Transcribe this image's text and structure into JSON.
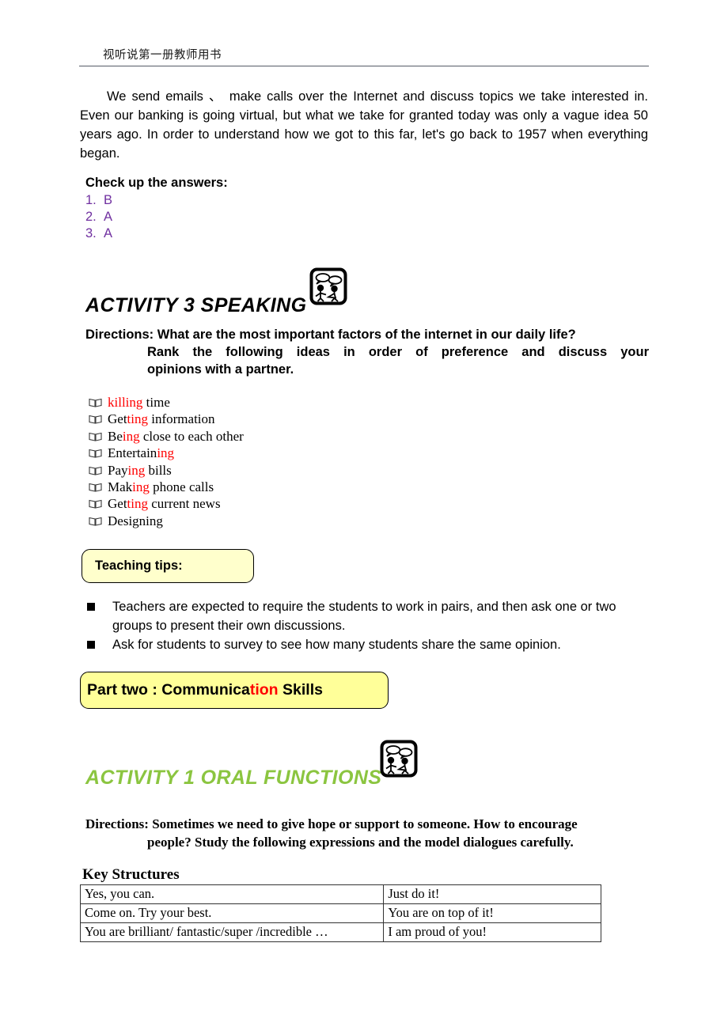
{
  "header": {
    "running_head": "视听说第一册教师用书"
  },
  "intro": {
    "paragraph": "We send emails 、 make calls over the Internet and discuss topics we take interested in. Even our banking is going virtual, but what we take for granted today was only a vague idea 50 years ago. In order to understand how we got to this far, let's go back to 1957 when everything began."
  },
  "answers": {
    "title": "Check up the answers:",
    "color": "#7030A0",
    "items": [
      {
        "number": "1.",
        "value": "B"
      },
      {
        "number": "2.",
        "value": "A"
      },
      {
        "number": "3.",
        "value": "A"
      }
    ]
  },
  "activity3": {
    "heading": "ACTIVITY 3 SPEAKING",
    "icon": "speaking-icon",
    "directions": {
      "line1": "Directions: What are the most important factors of the internet in our daily life?",
      "line2": "Rank the following ideas in order of preference and discuss your",
      "line3": "opinions with a partner."
    },
    "ideas": [
      {
        "plain_before": "",
        "highlight": "killing",
        "plain_after": " time"
      },
      {
        "plain_before": "Get",
        "highlight": "ting",
        "plain_after": " information"
      },
      {
        "plain_before": "Be",
        "highlight": "ing",
        "plain_after": " close to each other"
      },
      {
        "plain_before": "Entertain",
        "highlight": "ing",
        "plain_after": ""
      },
      {
        "plain_before": "Pay",
        "highlight": "ing",
        "plain_after": " bills"
      },
      {
        "plain_before": "Mak",
        "highlight": "ing",
        "plain_after": " phone calls"
      },
      {
        "plain_before": "Get",
        "highlight": "ting",
        "plain_after": " current news"
      },
      {
        "plain_before": "Designing",
        "highlight": "",
        "plain_after": ""
      }
    ],
    "highlight_color": "#FF0000"
  },
  "teaching_tips": {
    "box_label": "Teaching tips:",
    "box_fill": "#FFFFCC",
    "items": [
      "Teachers are expected to require the students to work in pairs, and then ask one or two groups to present their own discussions.",
      "Ask for students to survey to see how many students share the same opinion."
    ]
  },
  "part_banner": {
    "text_before": "Part two : Communica",
    "text_highlight": "tion",
    "text_after": " Skills",
    "fill": "#FFFF99",
    "highlight_color": "#FF0000"
  },
  "activity1": {
    "heading": "ACTIVITY 1 ORAL FUNCTIONS",
    "heading_color": "#8BC540",
    "icon": "speaking-icon",
    "directions": {
      "line1": "Directions: Sometimes we need to give hope or support to someone. How to encourage",
      "line2": "people? Study the following expressions and the model dialogues carefully."
    }
  },
  "key_structures": {
    "title": "Key Structures",
    "rows": [
      {
        "left": "Yes, you can.",
        "right": "Just do it!"
      },
      {
        "left": "Come on. Try your best.",
        "right": "You are on top of it!"
      },
      {
        "left": "You are brilliant/ fantastic/super /incredible …",
        "right": "I am proud of you!"
      }
    ]
  }
}
